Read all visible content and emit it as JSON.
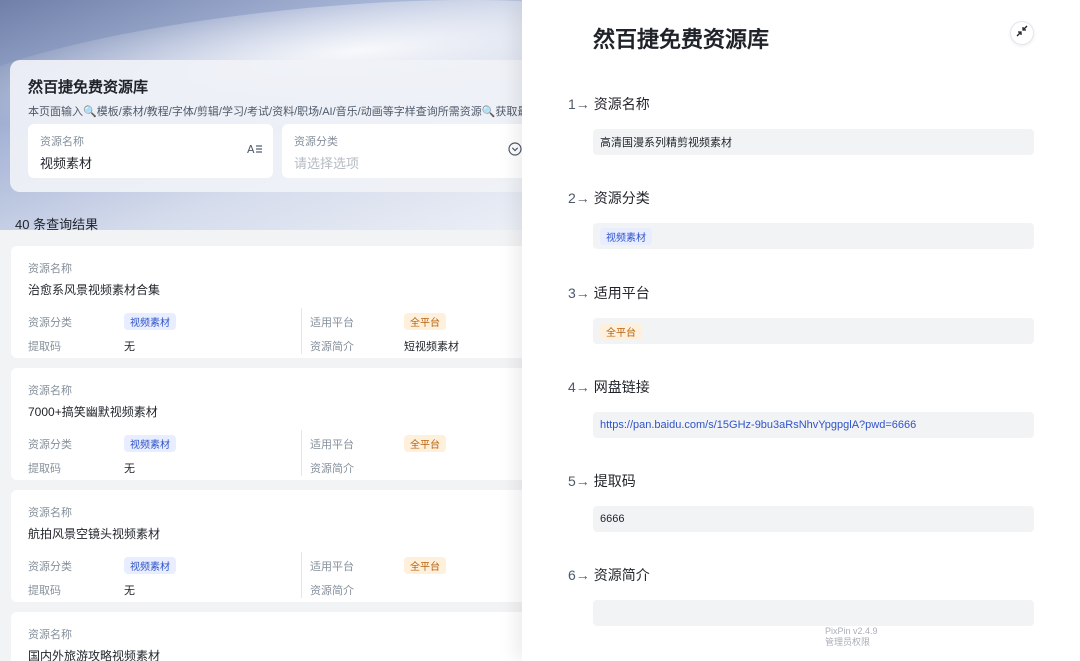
{
  "app": {
    "title": "然百捷免费资源库",
    "description": "本页面输入🔍模板/素材/教程/字体/剪辑/学习/考试/资料/职场/AI/音乐/动画等字样查询所需资源🔍获取最新"
  },
  "search": {
    "name_label": "资源名称",
    "name_value": "视频素材",
    "category_label": "资源分类",
    "category_placeholder": "请选择选项"
  },
  "results": {
    "count_text": "40 条查询结果",
    "field_labels": {
      "name": "资源名称",
      "category": "资源分类",
      "platform": "适用平台",
      "code": "提取码",
      "intro": "资源简介"
    },
    "items": [
      {
        "name": "治愈系风景视频素材合集",
        "category": "视频素材",
        "platform": "全平台",
        "code": "无",
        "intro": "短视频素材"
      },
      {
        "name": "7000+搞笑幽默视频素材",
        "category": "视频素材",
        "platform": "全平台",
        "code": "无",
        "intro": ""
      },
      {
        "name": "航拍风景空镜头视频素材",
        "category": "视频素材",
        "platform": "全平台",
        "code": "无",
        "intro": ""
      },
      {
        "name": "国内外旅游攻略视频素材",
        "category": "",
        "platform": "",
        "code": "",
        "intro": ""
      }
    ]
  },
  "drawer": {
    "title": "然百捷免费资源库",
    "fields": [
      {
        "num": "1→",
        "label": "资源名称",
        "value": "高清国漫系列精剪视频素材"
      },
      {
        "num": "2→",
        "label": "资源分类",
        "value": "视频素材"
      },
      {
        "num": "3→",
        "label": "适用平台",
        "value": "全平台"
      },
      {
        "num": "4→",
        "label": "网盘链接",
        "value": "https://pan.baidu.com/s/15GHz-9bu3aRsNhvYpgpglA?pwd=6666"
      },
      {
        "num": "5→",
        "label": "提取码",
        "value": "6666"
      },
      {
        "num": "6→",
        "label": "资源简介",
        "value": ""
      }
    ]
  },
  "watermark": {
    "line1": "PixPin v2.4.9",
    "line2": "管理员权限"
  },
  "colors": {
    "accent": "#2f54c9",
    "tag_blue_bg": "#e8edff",
    "tag_orange_bg": "#fff0dc",
    "tag_orange_text": "#b5620f"
  },
  "icons": {
    "name_field": "text-format-icon",
    "category_field": "chevron-down-circle-icon",
    "collapse": "collapse-arrows-icon"
  }
}
